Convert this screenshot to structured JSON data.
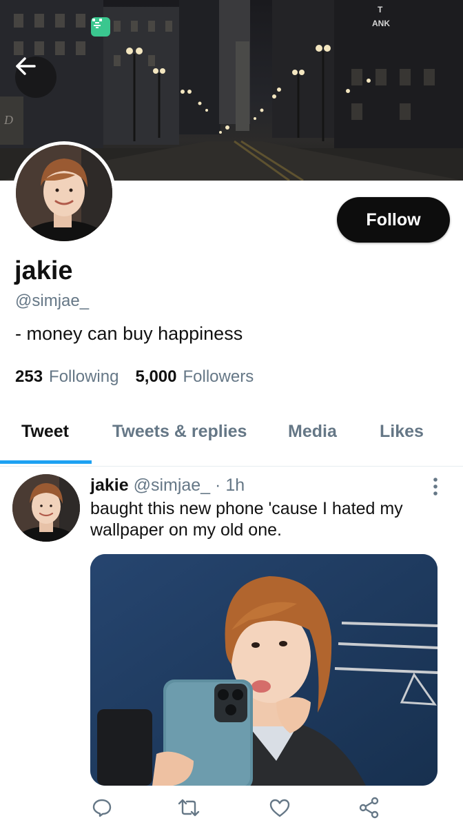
{
  "profile": {
    "display_name": "jakie",
    "handle": "@simjae_",
    "bio": "- money can buy happiness",
    "following_count": "253",
    "following_label": "Following",
    "followers_count": "5,000",
    "followers_label": "Followers",
    "follow_label": "Follow"
  },
  "banner": {
    "sign_text": "T\nANK"
  },
  "tabs": [
    {
      "label": "Tweet",
      "active": true
    },
    {
      "label": "Tweets & replies",
      "active": false
    },
    {
      "label": "Media",
      "active": false
    },
    {
      "label": "Likes",
      "active": false
    }
  ],
  "tweet": {
    "name": "jakie",
    "handle": "@simjae_",
    "separator": "·",
    "time": "1h",
    "text": "baught this new phone 'cause I hated my wallpaper on my old one."
  },
  "icons": {
    "back": "back-arrow-icon",
    "app_badge": "app-badge-icon",
    "more": "more-vertical-icon",
    "reply": "reply-icon",
    "retweet": "retweet-icon",
    "like": "heart-icon",
    "share": "share-icon"
  },
  "colors": {
    "accent": "#1da1f2",
    "secondary_text": "#657786",
    "follow_button": "#0d0d0d"
  }
}
